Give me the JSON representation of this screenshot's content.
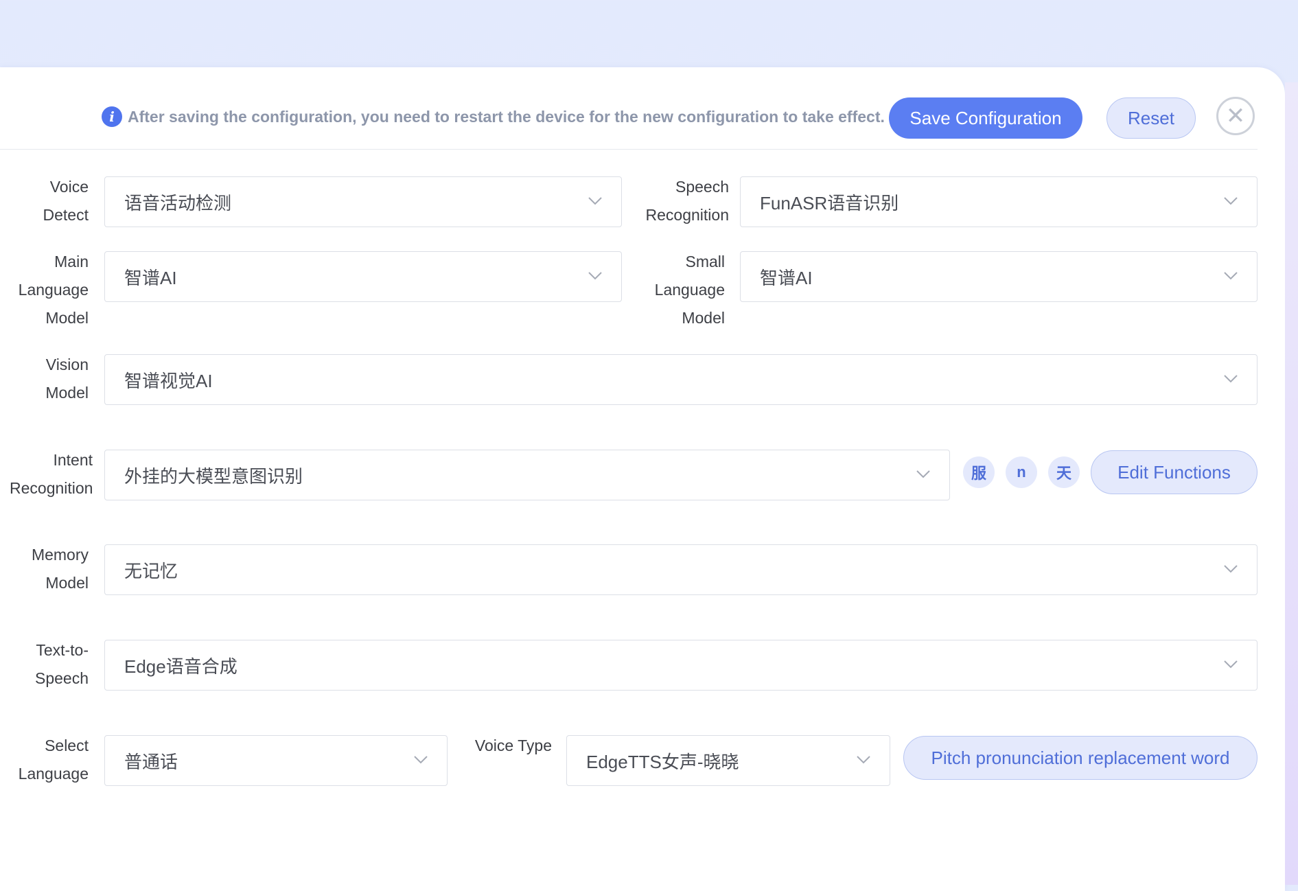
{
  "notice": {
    "icon": "info-icon",
    "text": "After saving the configuration, you need to restart the device for the new configuration to take effect."
  },
  "actions": {
    "save_label": "Save Configuration",
    "reset_label": "Reset",
    "close_icon": "close-icon",
    "close_glyph": "✕"
  },
  "fields": {
    "vad": {
      "label1": "Voice",
      "label2": "Detect",
      "value": "语音活动检测"
    },
    "asr": {
      "label1": "Speech",
      "label2": "Recognition",
      "value": "FunASR语音识别"
    },
    "llm": {
      "label1": "Main",
      "label2": "Language",
      "label3": "Model",
      "value": "智谱AI"
    },
    "slm": {
      "label1": "Small",
      "label2": "Language",
      "label3": "Model",
      "value": "智谱AI"
    },
    "vllm": {
      "label1": "Vision",
      "label2": "Model",
      "value": "智谱视觉AI"
    },
    "intent": {
      "label1": "Intent",
      "label2": "Recognition",
      "value": "外挂的大模型意图识别",
      "tags": [
        "服",
        "n",
        "天"
      ],
      "edit_label": "Edit Functions"
    },
    "memory": {
      "label1": "Memory",
      "label2": "Model",
      "value": "无记忆"
    },
    "tts": {
      "label1": "Text-to-",
      "label2": "Speech",
      "value": "Edge语音合成"
    },
    "language": {
      "label1": "Select",
      "label2": "Language",
      "value": "普通话"
    },
    "voice": {
      "label": "Voice Type",
      "value": "EdgeTTS女声-晓晓"
    },
    "pitch_label": "Pitch pronunciation replacement word"
  },
  "colors": {
    "accent": "#5b7ef2",
    "accent_soft": "#e4e9fc",
    "accent_text": "#4f6ed8",
    "background": "#e3eafd"
  }
}
